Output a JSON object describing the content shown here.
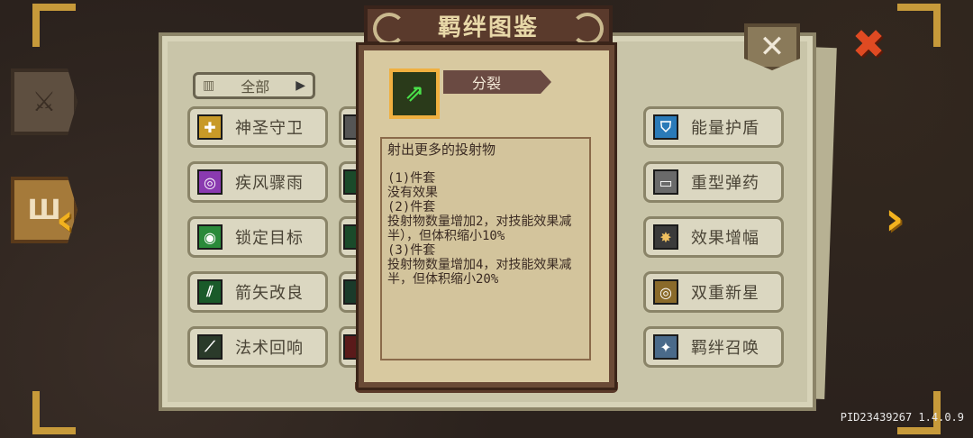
{
  "header": {
    "title": "羁绊图鉴"
  },
  "filter": {
    "label": "全部"
  },
  "bonds_left": [
    "神圣守卫",
    "疾风骤雨",
    "锁定目标",
    "箭矢改良",
    "法术回响"
  ],
  "bonds_right": [
    "能量护盾",
    "重型弹药",
    "效果增幅",
    "双重新星",
    "羁绊召唤"
  ],
  "popup": {
    "skill_name": "分裂",
    "summary": "射出更多的投射物",
    "details": "(1)件套\n没有效果\n(2)件套\n投射物数量增加2，对技能效果减半），但体积缩小10%\n(3)件套\n投射物数量增加4，对技能效果减半，但体积缩小20%"
  },
  "footer": {
    "pid": "PID23439267 1.4.0.9"
  },
  "colors": {
    "accent_gold": "#f2b21e",
    "close_red": "#e04a22",
    "skill_green": "#4ae24a"
  },
  "icons": {
    "close": "close-icon",
    "nav_left": "chevron-left-icon",
    "nav_right": "chevron-right-icon",
    "sword_tab": "sword-icon",
    "book_tab": "book-icon"
  }
}
